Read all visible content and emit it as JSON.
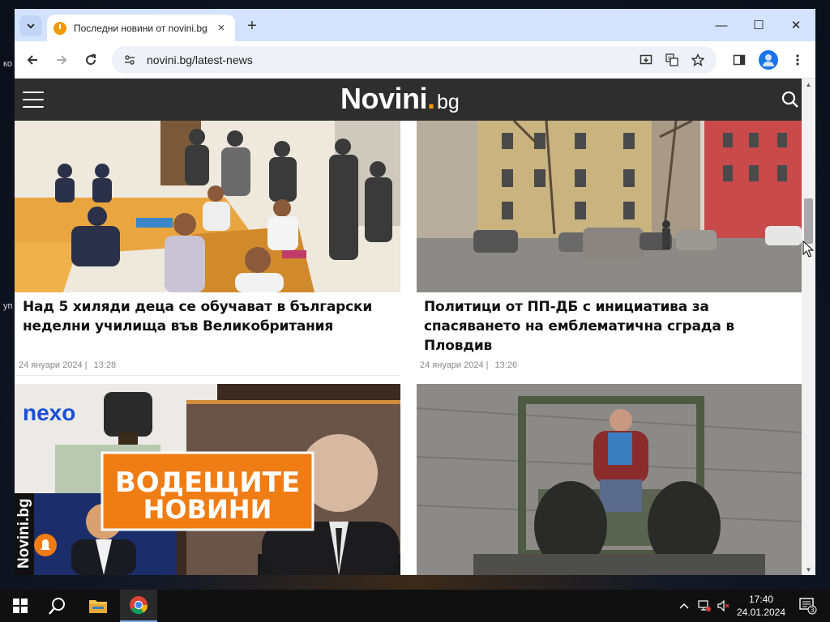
{
  "desktop": {
    "fragment_top": "ко",
    "fragment_mid": "уп"
  },
  "browser": {
    "tab": {
      "title": "Последни новини от novini.bg"
    },
    "window_controls": {
      "minimize": "—",
      "maximize": "☐",
      "close": "✕"
    },
    "address": {
      "url": "novini.bg/latest-news"
    }
  },
  "site": {
    "logo_main": "Novini",
    "logo_dot": ".",
    "logo_suffix": "bg"
  },
  "articles": [
    {
      "title": "Над 5 хиляди деца се обучават в български неделни училища във Великобритания",
      "date": "24 януари 2024 |",
      "time": "13:28"
    },
    {
      "title": "Политици от ПП-ДБ с инициатива за спасяването на емблематична сграда в Пловдив",
      "date": "24 януари 2024 |",
      "time": "13:26"
    },
    {
      "image_brand_left": "nexo",
      "image_banner_line1": "ВОДЕЩИТЕ",
      "image_banner_line2": "НОВИНИ",
      "image_vertical_brand": "Novini.bg"
    },
    {}
  ],
  "colors": {
    "accent": "#f29900",
    "header_bg": "#2e2e2e",
    "tab_strip": "#d3e3fd",
    "banner_orange": "#f07c14",
    "nexo_blue": "#1a4fd6"
  },
  "taskbar": {
    "time": "17:40",
    "date": "24.01.2024",
    "notification_count": "3",
    "icons": [
      "start-icon",
      "search-icon",
      "file-explorer-icon",
      "chrome-icon"
    ]
  }
}
